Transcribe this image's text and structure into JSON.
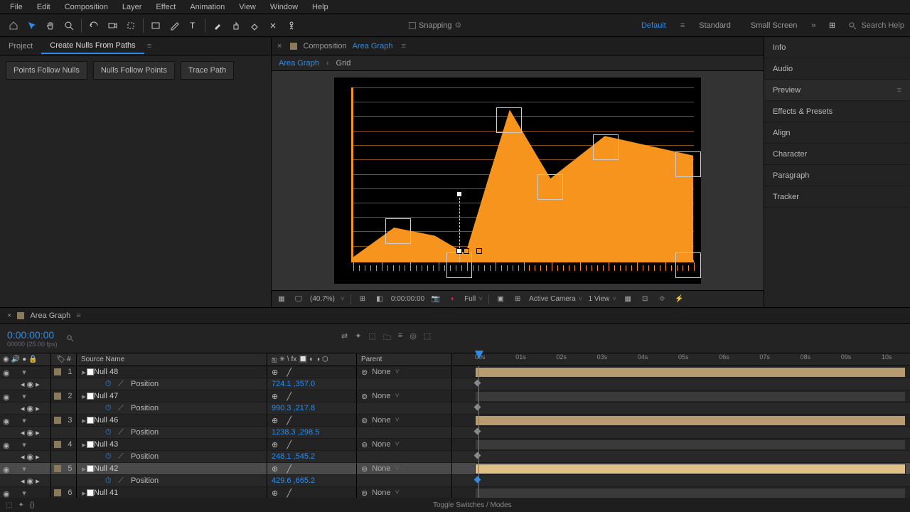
{
  "menu": [
    "File",
    "Edit",
    "Composition",
    "Layer",
    "Effect",
    "Animation",
    "View",
    "Window",
    "Help"
  ],
  "toolbar": {
    "snapping": "Snapping",
    "workspaces": [
      "Default",
      "Standard",
      "Small Screen"
    ],
    "search_placeholder": "Search Help"
  },
  "left_panel": {
    "tabs": [
      "Project",
      "Create Nulls From Paths"
    ],
    "buttons": [
      "Points Follow Nulls",
      "Nulls Follow Points",
      "Trace Path"
    ]
  },
  "comp": {
    "label": "Composition",
    "name": "Area Graph",
    "breadcrumb": [
      "Area Graph",
      "Grid"
    ]
  },
  "viewer_footer": {
    "zoom": "(40.7%)",
    "time": "0:00:00:00",
    "resolution": "Full",
    "camera": "Active Camera",
    "views": "1 View"
  },
  "right_panels": [
    "Info",
    "Audio",
    "Preview",
    "Effects & Presets",
    "Align",
    "Character",
    "Paragraph",
    "Tracker"
  ],
  "timeline": {
    "name": "Area Graph",
    "time": "0:00:00:00",
    "fps": "00000 (25.00 fps)",
    "col_source": "Source Name",
    "col_parent": "Parent",
    "col_switches": "ஐ ✳ \\ fx 🔲 ◐ ◑ ⬡",
    "ruler": [
      "00s",
      "01s",
      "02s",
      "03s",
      "04s",
      "05s",
      "06s",
      "07s",
      "08s",
      "09s",
      "10s"
    ],
    "layers": [
      {
        "num": "1",
        "name": "Null 48",
        "pos": "724.1 ,357.0",
        "kf_x": 32
      },
      {
        "num": "2",
        "name": "Null 47",
        "pos": "990.3 ,217.8",
        "kf_x": 32
      },
      {
        "num": "3",
        "name": "Null 46",
        "pos": "1238.3 ,298.5",
        "kf_x": 32
      },
      {
        "num": "4",
        "name": "Null 43",
        "pos": "248.1 ,545.2",
        "kf_x": 32
      },
      {
        "num": "5",
        "name": "Null 42",
        "pos": "429.6 ,665.2",
        "kf_x": 32,
        "sel": true
      },
      {
        "num": "6",
        "name": "Null 41",
        "pos": "",
        "kf_x": 32
      }
    ],
    "prop_name": "Position",
    "parent_none": "None",
    "toggle": "Toggle Switches / Modes"
  },
  "chart_data": {
    "type": "area",
    "title": "Area Graph",
    "points_norm_x": [
      0,
      0.12,
      0.24,
      0.33,
      0.4,
      0.46,
      0.58,
      0.74,
      1.0
    ],
    "points_norm_y": [
      0.02,
      0.2,
      0.15,
      0.04,
      0.52,
      0.92,
      0.5,
      0.76,
      0.64
    ],
    "ylim": [
      0,
      1
    ],
    "gridlines": 12
  }
}
